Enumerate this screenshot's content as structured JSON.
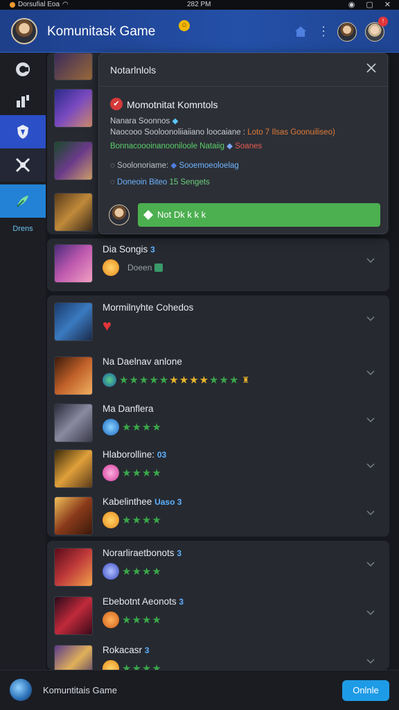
{
  "status_bar": {
    "carrier": "Dorsufial Eoa",
    "time": "282 PM"
  },
  "header": {
    "title": "Komunitask Game",
    "badge": "☺",
    "notification_count": "!"
  },
  "sidebar": {
    "label": "Drens",
    "items": [
      "browse",
      "stats",
      "quests",
      "battle",
      "create"
    ]
  },
  "popup": {
    "title": "Notarlnlols",
    "item_title": "Momotnitat Komntols",
    "line1": "Nanara Soonnos",
    "line2_text": "Naocooo Sooloonoliiaiiano loocaiane :",
    "line2_highlight": "Loto 7 Ilsas Goonuiliseo)",
    "line3_text": "Bonnacoooinanooniloole Nataiig",
    "line3_highlight": "Soanes",
    "line4_prefix": "Soolonoriame:",
    "line4_link": "Sooemoeoloelag",
    "line5_text": "Doneoin Biteo",
    "line5_count": "15",
    "line5_suffix": "Sengets",
    "action_label": "Not Dk k k k"
  },
  "rows": [
    {
      "name": "Dia Songis",
      "num": "3",
      "sub": "Doeen"
    },
    {
      "name": "Mormilnyhte Cohedos",
      "num": ""
    },
    {
      "name": "Na Daelnav anlone",
      "num": ""
    },
    {
      "name": "Ma Danflera",
      "num": ""
    },
    {
      "name": "Hlaborolline:",
      "num": "03"
    },
    {
      "name": "Kabelinthee",
      "num": "Uaso 3"
    },
    {
      "name": "Norarliraetbonots",
      "num": "3"
    },
    {
      "name": "Ebebotnt Aeonots",
      "num": "3"
    },
    {
      "name": "Rokacasr",
      "num": "3"
    }
  ],
  "footer": {
    "title": "Komuntitais Game",
    "online_label": "Onlnle"
  },
  "colors": {
    "accent": "#2450a8",
    "green": "#4caf50",
    "online": "#1e9be6"
  }
}
